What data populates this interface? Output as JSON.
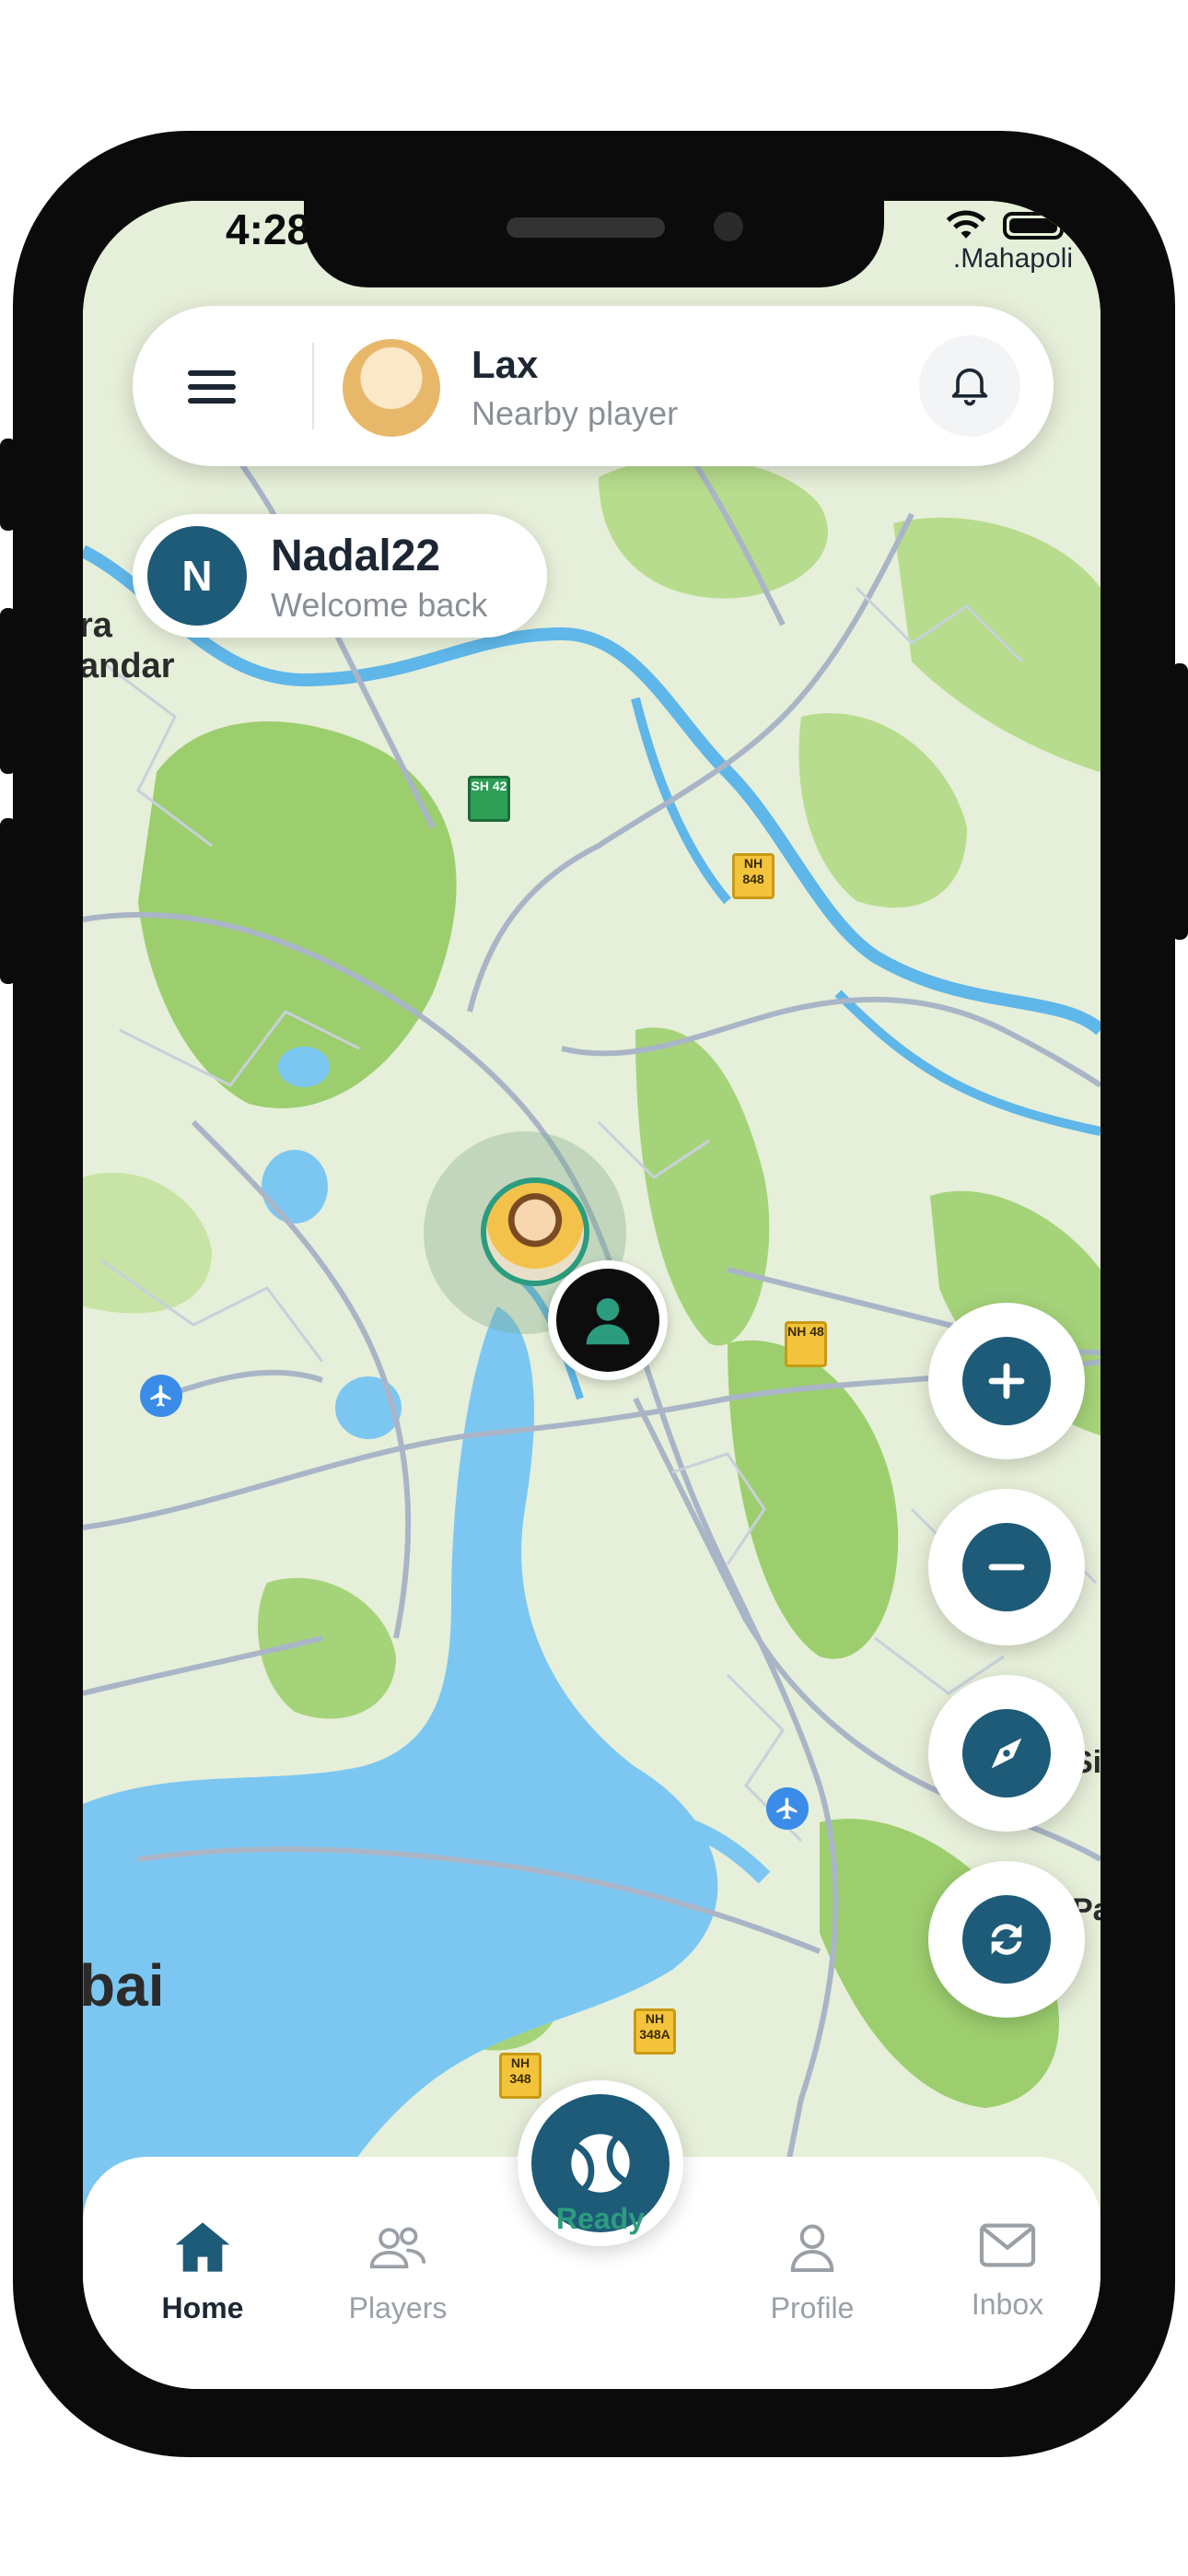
{
  "status_bar": {
    "time": "4:28",
    "location": ".Mahapoli"
  },
  "top_card": {
    "name": "Lax",
    "subtitle": "Nearby player"
  },
  "welcome": {
    "initial": "N",
    "name": "Nadal22",
    "subtitle": "Welcome back"
  },
  "map": {
    "labels": {
      "ra_fragment": "ra",
      "andar_fragment": "andar",
      "bai_fragment": "bai",
      "right_edge_1": "Si",
      "right_edge_2": "Pa",
      "sh42": "SH 42",
      "nh848": "NH 848",
      "nh48": "NH 48",
      "nh348": "NH 348",
      "nh348a": "NH 348A"
    }
  },
  "controls": {
    "zoom_in": "zoom-in",
    "zoom_out": "zoom-out",
    "compass": "compass",
    "refresh": "refresh"
  },
  "bottom_nav": {
    "home": "Home",
    "players": "Players",
    "ready": "Ready",
    "profile": "Profile",
    "inbox": "Inbox"
  },
  "colors": {
    "accent": "#1d5b78",
    "ready_green": "#2c9c7f",
    "water": "#7cc7f2",
    "land": "#dfeccf",
    "forest": "#9cce6e"
  }
}
